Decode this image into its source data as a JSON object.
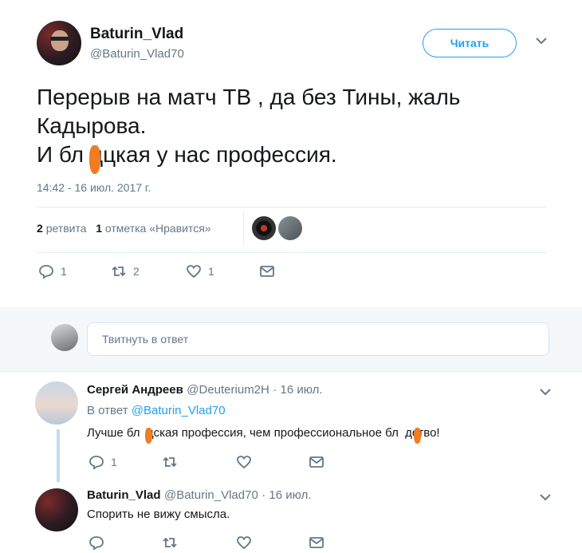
{
  "tweet": {
    "author_name": "Baturin_Vlad",
    "author_handle": "@Baturin_Vlad70",
    "follow_label": "Читать",
    "text": "Перерыв на матч ТВ , да без Тины, жаль\nКадырова.\nИ бл  дцкая у нас профессия.",
    "timestamp": "14:42 - 16 июл. 2017 г.",
    "retweets_count": "2",
    "retweets_label": "ретвита",
    "likes_count": "1",
    "likes_label": "отметка «Нравится»",
    "actions": {
      "reply_count": "1",
      "retweet_count": "2",
      "like_count": "1"
    }
  },
  "reply_box": {
    "placeholder": "Твитнуть в ответ"
  },
  "replies": [
    {
      "name": "Сергей Андреев",
      "handle": "@Deuterium2H",
      "date": "· 16 июл.",
      "in_reply_prefix": "В ответ",
      "in_reply_handle": "@Baturin_Vlad70",
      "text": "Лучше бл  дская профессия, чем профессиональное бл  дство!",
      "reply_count": "1"
    },
    {
      "name": "Baturin_Vlad",
      "handle": "@Baturin_Vlad70",
      "date": "· 16 июл.",
      "text": "Спорить не вижу смысла."
    }
  ],
  "colors": {
    "accent": "#1da1f2",
    "muted": "#657786",
    "censor": "#f27c20"
  },
  "icons": [
    "reply-icon",
    "retweet-icon",
    "like-icon",
    "message-icon",
    "chevron-down-icon"
  ]
}
